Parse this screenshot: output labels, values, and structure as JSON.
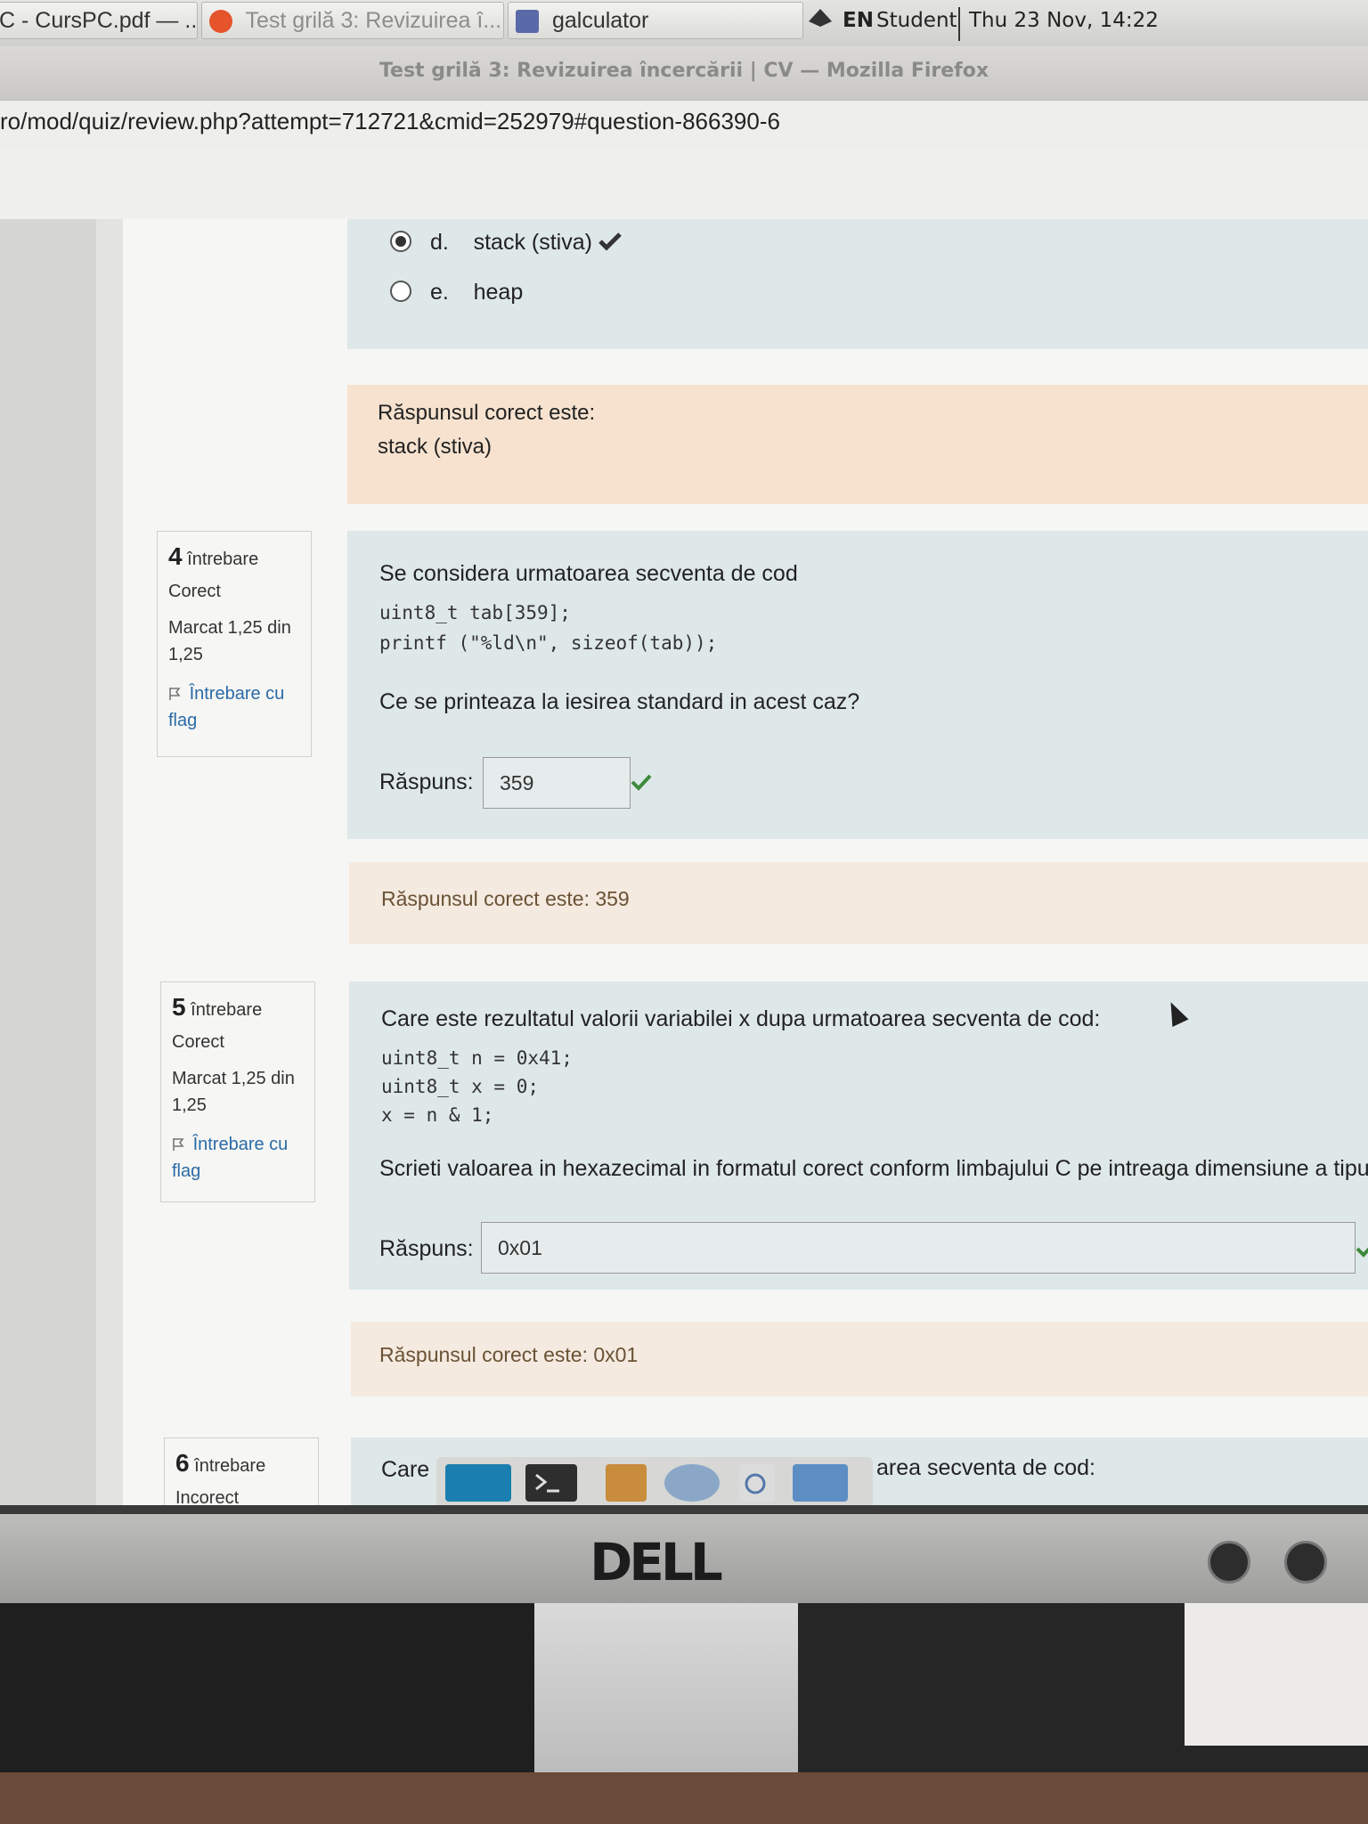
{
  "taskbar": {
    "tasks": [
      {
        "label": "C - CursPC.pdf — ..."
      },
      {
        "label": "Test grilă 3: Revizuirea î..."
      },
      {
        "label": "galculator"
      }
    ],
    "keyboard_layout": "EN",
    "user": "Student",
    "datetime": "Thu 23 Nov, 14:22"
  },
  "window": {
    "title": "Test grilă 3: Revizuirea încercării | CV — Mozilla Firefox",
    "url": "ro/mod/quiz/review.php?attempt=712721&cmid=252979#question-866390-6"
  },
  "q3": {
    "options": [
      {
        "letter": "d.",
        "text": "stack (stiva)",
        "selected": true,
        "correct": true
      },
      {
        "letter": "e.",
        "text": "heap",
        "selected": false
      }
    ],
    "feedback_title": "Răspunsul corect este:",
    "feedback_answer": "stack (stiva)"
  },
  "q4": {
    "number": "4",
    "label": "întrebare",
    "state": "Corect",
    "grade": "Marcat 1,25 din 1,25",
    "flag": "Întrebare cu flag",
    "text": "Se considera urmatoarea secventa de cod",
    "code_line1": "uint8_t tab[359];",
    "code_line2": "printf (\"%ld\\n\", sizeof(tab));",
    "prompt": "Ce se printeaza la iesirea standard in acest caz?",
    "answer_label": "Răspuns:",
    "answer_value": "359",
    "feedback": "Răspunsul corect este: 359"
  },
  "q5": {
    "number": "5",
    "label": "întrebare",
    "state": "Corect",
    "grade": "Marcat 1,25 din 1,25",
    "flag": "Întrebare cu flag",
    "text": "Care este rezultatul valorii variabilei x dupa urmatoarea secventa de cod:",
    "code_line1": "uint8_t n = 0x41;",
    "code_line2": "uint8_t x = 0;",
    "code_line3": "x = n & 1;",
    "prompt": "Scrieti valoarea in hexazecimal in formatul corect conform limbajului C pe intreaga dimensiune a tipulu",
    "answer_label": "Răspuns:",
    "answer_value": "0x01",
    "feedback": "Răspunsul corect este: 0x01"
  },
  "q6": {
    "number": "6",
    "label": "întrebare",
    "state": "Incorect",
    "text_start": "Care (",
    "text_end": "area secventa de cod:"
  },
  "monitor": {
    "brand": "DELL"
  },
  "colors": {
    "question_bg": "#dfe8e8",
    "feedback_bg": "#f6e2cf",
    "correct_check": "#3c8a3c",
    "link": "#2b6aa6"
  }
}
